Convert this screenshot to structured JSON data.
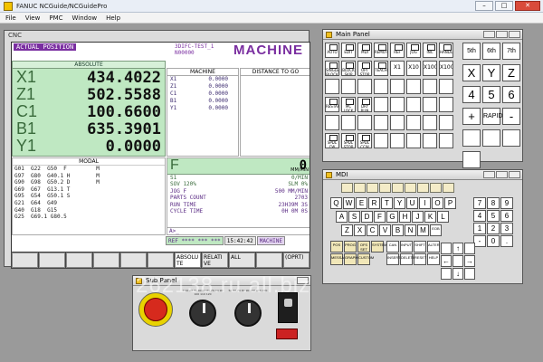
{
  "app": {
    "title": "FANUC NCGuide/NCGuidePro"
  },
  "menu": [
    "File",
    "View",
    "PMC",
    "Window",
    "Help"
  ],
  "cnc": {
    "window_title": "CNC",
    "header": {
      "label": "ACTUAL POSITION",
      "program": "3DIFC-TEST_1",
      "program_no": "N00000",
      "mode_badge": "MACHINE"
    },
    "absolute": {
      "label": "ABSOLUTE",
      "axes": [
        {
          "name": "X1",
          "value": "434.4022"
        },
        {
          "name": "Z1",
          "value": "502.5588"
        },
        {
          "name": "C1",
          "value": "100.6600"
        },
        {
          "name": "B1",
          "value": "635.3901"
        },
        {
          "name": "Y1",
          "value": "0.0000"
        }
      ]
    },
    "machine": {
      "label": "MACHINE",
      "rows": [
        {
          "name": "X1",
          "value": "0.0000"
        },
        {
          "name": "Z1",
          "value": "0.0000"
        },
        {
          "name": "C1",
          "value": "0.0000"
        },
        {
          "name": "B1",
          "value": "0.0000"
        },
        {
          "name": "Y1",
          "value": "0.0000"
        }
      ]
    },
    "distance": {
      "label": "DISTANCE TO GO"
    },
    "modal": {
      "label": "MODAL",
      "lines": [
        "G01  G22  G50  F         M",
        "G97  G80  G40.1 H        M",
        "G90  G98  G50.2 D        M",
        "G69  G67  G13.1 T",
        "G95  G54  G50.1 S",
        "G21  G64  G49",
        "G40  G18  G15",
        "G25  G69.1 G80.5"
      ]
    },
    "feed": {
      "label": "F",
      "value": "0",
      "unit": "MM/MIN"
    },
    "info": [
      {
        "k": "S1",
        "v": "0/MIN"
      },
      {
        "k": "SOV  120%",
        "v": "SLM  0%"
      },
      {
        "k": "JOG F",
        "v": "500 MM/MIN"
      },
      {
        "k": "PARTS COUNT",
        "v": "2703"
      },
      {
        "k": "RUN TIME",
        "v": "23H39M 3S"
      },
      {
        "k": "CYCLE TIME",
        "v": "0H 0M 0S"
      }
    ],
    "prompt": "A>_",
    "status": {
      "ref": "REF **** *** ***",
      "time": "15:42:42",
      "mode": "MACHINE"
    },
    "softkeys": [
      "",
      "",
      "",
      "",
      "",
      "",
      "ABSOLU TE",
      "RELATI VE",
      "ALL",
      "",
      "(OPRT)",
      ""
    ]
  },
  "main_panel": {
    "window_title": "Main Panel",
    "keys": [
      "AUTO",
      "EDIT",
      "MDI",
      "REMOTE",
      "REF",
      "JOG",
      "INC",
      "HANDLE",
      "SINGLE BLOCK",
      "BLOCK SKIP",
      "OPT STOP",
      "TEACH",
      "X1",
      "X10",
      "X100",
      "X1000",
      "",
      "",
      "",
      "",
      "",
      "",
      "",
      "",
      "RESTART",
      "MC LOCK",
      "DRY RUN",
      "",
      "",
      "",
      "",
      "",
      "",
      "",
      "",
      "",
      "",
      "",
      "",
      "",
      "SPDL CW",
      "SPDL STOP",
      "SPDL CCW",
      "",
      "",
      "",
      "",
      ""
    ],
    "axis_keys": [
      "5th",
      "6th",
      "7th",
      "X",
      "Y",
      "Z",
      "4",
      "5",
      "6",
      "+",
      "RAPID",
      "-",
      "",
      "",
      "",
      ""
    ]
  },
  "mdi": {
    "window_title": "MDI",
    "row1": [
      "",
      "",
      "",
      "",
      "",
      "",
      "",
      "",
      ""
    ],
    "keys_row_q": [
      "Q",
      "W",
      "E",
      "R",
      "T",
      "Y",
      "U",
      "I",
      "O",
      "P"
    ],
    "keys_row_a": [
      "A",
      "S",
      "D",
      "F",
      "G",
      "H",
      "J",
      "K",
      "L"
    ],
    "keys_row_z": [
      "Z",
      "X",
      "C",
      "V",
      "B",
      "N",
      "M",
      "EOB"
    ],
    "numpad": [
      "7",
      "8",
      "9",
      "4",
      "5",
      "6",
      "1",
      "2",
      "3",
      "-",
      "0",
      "."
    ],
    "side_keys": [
      "CAN",
      "INPUT",
      "SHIFT",
      "ALTER",
      "INSERT",
      "DELETE",
      "RESET",
      "HELP"
    ],
    "ctrl_keys": [
      "POS",
      "PROG",
      "OFS SET",
      "SYSTEM",
      "MESSAGE",
      "GRAPH",
      "CUSTOM"
    ],
    "extra": [
      "PAGE UP",
      "PAGE DOWN",
      "ABC/abc",
      "?",
      "IN1",
      "IN2",
      "RESET"
    ]
  },
  "sub_panel": {
    "window_title": "Sub Panel",
    "dial1_ticks": "0 10 20 30 40 50 60 70 80 90 100 110 120",
    "dial2_ticks": "50 60 70 80 90 100 110 120"
  },
  "watermark": "262138.ru.all.biz"
}
